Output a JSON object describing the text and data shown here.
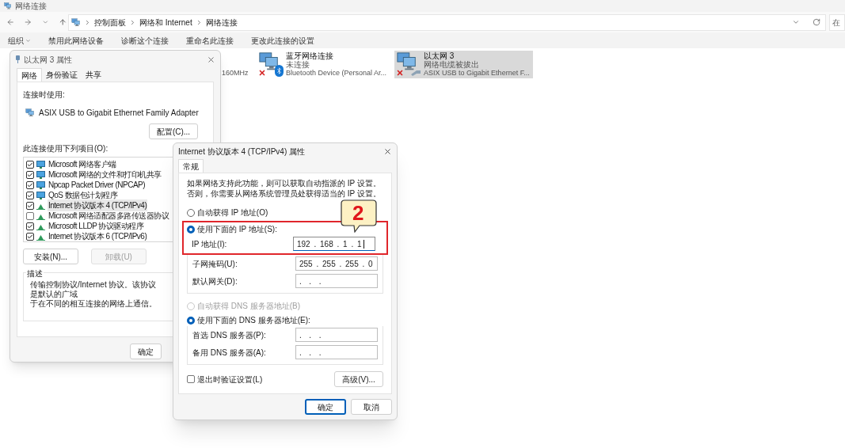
{
  "window": {
    "title": "网络连接"
  },
  "address_bar": {
    "breadcrumbs": [
      "控制面板",
      "网络和 Internet",
      "网络连接"
    ]
  },
  "search": {
    "placeholder": "在"
  },
  "toolbar": {
    "items": [
      {
        "label": "组织",
        "kind": "menu"
      },
      {
        "label": "禁用此网络设备",
        "kind": "command"
      },
      {
        "label": "诊断这个连接",
        "kind": "command"
      },
      {
        "label": "重命名此连接",
        "kind": "command"
      },
      {
        "label": "更改此连接的设置",
        "kind": "command"
      }
    ]
  },
  "connections": [
    {
      "kind": "partial",
      "device": "160MHz",
      "selected": false
    },
    {
      "kind": "bluetooth",
      "name": "蓝牙网络连接",
      "status": "未连接",
      "device": "Bluetooth Device (Personal Ar...",
      "selected": false,
      "disconnected": true
    },
    {
      "kind": "ethernet",
      "name": "以太网 3",
      "status": "网络电缆被拔出",
      "device": "ASIX USB to Gigabit Ethernet F...",
      "selected": true,
      "disconnected": true
    }
  ],
  "properties_dialog": {
    "title": "以太网 3 属性",
    "tabs": [
      {
        "label": "网络",
        "selected": true
      },
      {
        "label": "身份验证",
        "selected": false
      },
      {
        "label": "共享",
        "selected": false
      }
    ],
    "connect_using_label": "连接时使用:",
    "adapter": "ASIX USB to Gigabit Ethernet Family Adapter",
    "configure_button": "配置(C)...",
    "items_label": "此连接使用下列项目(O):",
    "items": [
      {
        "label": "Microsoft 网络客户端",
        "kind": "client",
        "checked": true,
        "selected": false
      },
      {
        "label": "Microsoft 网络的文件和打印机共享",
        "kind": "client",
        "checked": true,
        "selected": false
      },
      {
        "label": "Npcap Packet Driver (NPCAP)",
        "kind": "client",
        "checked": true,
        "selected": false
      },
      {
        "label": "QoS 数据包计划程序",
        "kind": "client",
        "checked": true,
        "selected": false
      },
      {
        "label": "Internet 协议版本 4 (TCP/IPv4)",
        "kind": "protocol",
        "checked": true,
        "selected": true
      },
      {
        "label": "Microsoft 网络适配器多路传送器协议",
        "kind": "protocol",
        "checked": false,
        "selected": false
      },
      {
        "label": "Microsoft LLDP 协议驱动程序",
        "kind": "protocol",
        "checked": true,
        "selected": false
      },
      {
        "label": "Internet 协议版本 6 (TCP/IPv6)",
        "kind": "protocol",
        "checked": true,
        "selected": false
      }
    ],
    "buttons": [
      {
        "label": "安装(N)...",
        "disabled": false
      },
      {
        "label": "卸载(U)",
        "disabled": true
      }
    ],
    "description": {
      "title": "描述",
      "lines": [
        "传输控制协议/Internet 协议。该协议是默认的广域",
        "于在不同的相互连接的网络上通信。"
      ]
    },
    "ok_button": "确定"
  },
  "ipv4_dialog": {
    "title": "Internet 协议版本 4 (TCP/IPv4) 属性",
    "tabs": [
      {
        "label": "常规",
        "selected": true
      }
    ],
    "intro": "如果网络支持此功能，则可以获取自动指派的 IP 设置。否则，你需要从网络系统管理员处获得适当的 IP 设置。",
    "ip_mode": [
      {
        "label": "自动获得 IP 地址(O)",
        "selected": false,
        "disabled": false
      },
      {
        "label": "使用下面的 IP 地址(S):",
        "selected": true,
        "disabled": false
      }
    ],
    "ip_fields": [
      {
        "label": "IP 地址(I):",
        "value": "192 . 168 . 1 . 1",
        "focused": true
      },
      {
        "label": "子网掩码(U):",
        "value": "255 . 255 . 255 . 0",
        "focused": false
      },
      {
        "label": "默认网关(D):",
        "value": ".  .  .",
        "focused": false
      }
    ],
    "dns_mode": [
      {
        "label": "自动获得 DNS 服务器地址(B)",
        "selected": false,
        "disabled": true
      },
      {
        "label": "使用下面的 DNS 服务器地址(E):",
        "selected": true,
        "disabled": false
      }
    ],
    "dns_fields": [
      {
        "label": "首选 DNS 服务器(P):",
        "value": ".  .  .",
        "focused": false
      },
      {
        "label": "备用 DNS 服务器(A):",
        "value": ".  .  .",
        "focused": false
      }
    ],
    "validate": {
      "label": "退出时验证设置(L)",
      "checked": false
    },
    "advanced_button": "高级(V)...",
    "buttons": [
      {
        "label": "确定",
        "default": true
      },
      {
        "label": "取消",
        "default": false
      }
    ]
  },
  "callout": {
    "text": "2"
  }
}
